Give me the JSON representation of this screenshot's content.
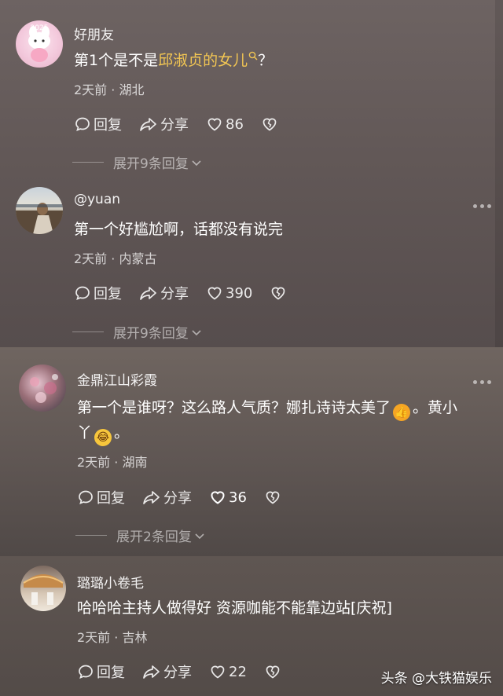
{
  "comments": [
    {
      "username": "好朋友",
      "text_before": "第1个是不是",
      "text_highlight": "邱淑贞的女儿",
      "text_after": "？",
      "meta": "2天前 · 湖北",
      "reply_label": "回复",
      "share_label": "分享",
      "likes": "86",
      "expand_label": "展开9条回复"
    },
    {
      "username": "@yuan",
      "text": "第一个好尴尬啊，话都没有说完",
      "meta": "2天前 · 内蒙古",
      "reply_label": "回复",
      "share_label": "分享",
      "likes": "390",
      "expand_label": "展开9条回复"
    },
    {
      "username": "金鼎江山彩霞",
      "text_line1": "第一个是谁呀？这么路人气质？娜扎诗诗太美了",
      "text_line1_end": "。黄小",
      "text_line2_start": "丫",
      "text_line2_end": "。",
      "meta": "2天前 · 湖南",
      "reply_label": "回复",
      "share_label": "分享",
      "likes": "36",
      "expand_label": "展开2条回复"
    },
    {
      "username": "璐璐小卷毛",
      "text": "哈哈哈主持人做得好  资源咖能不能靠边站[庆祝]",
      "meta": "2天前 · 吉林",
      "reply_label": "回复",
      "share_label": "分享",
      "likes": "22"
    }
  ],
  "watermark": "头条 @大铁猫娱乐",
  "icons": {
    "search": "search-icon",
    "reply": "reply-icon",
    "share": "share-icon",
    "like": "heart-icon",
    "dislike": "broken-heart-icon",
    "more": "more-icon"
  },
  "colors": {
    "highlight": "#f2c653"
  }
}
